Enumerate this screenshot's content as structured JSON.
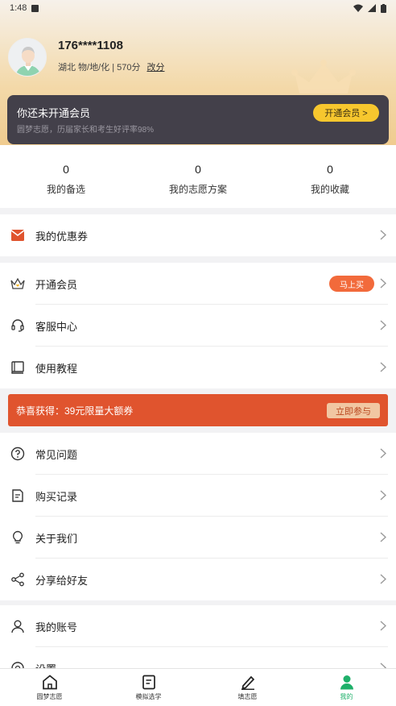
{
  "status_bar": {
    "time": "1:48"
  },
  "profile": {
    "phone": "176****1108",
    "info": "湖北 物/地/化 | 570分",
    "edit_label": "改分"
  },
  "vip": {
    "title": "你还未开通会员",
    "subtitle": "圆梦志愿，历届家长和考生好评率98%",
    "button": "开通会员 >"
  },
  "stats": [
    {
      "value": "0",
      "label": "我的备选"
    },
    {
      "value": "0",
      "label": "我的志愿方案"
    },
    {
      "value": "0",
      "label": "我的收藏"
    }
  ],
  "menu": {
    "coupon": "我的优惠券",
    "open_vip": "开通会员",
    "buy_now": "马上买",
    "service": "客服中心",
    "tutorial": "使用教程",
    "faq": "常见问题",
    "purchase": "购买记录",
    "about": "关于我们",
    "share": "分享给好友",
    "account": "我的账号",
    "settings": "设置"
  },
  "promo": {
    "text": "恭喜获得：39元限量大额券",
    "button": "立即参与"
  },
  "tabs": [
    {
      "label": "圆梦志愿"
    },
    {
      "label": "模拟选学"
    },
    {
      "label": "填志愿"
    },
    {
      "label": "我的"
    }
  ],
  "colors": {
    "accent": "#1fb06a",
    "promo": "#e0542e",
    "vip_button": "#f7c72e",
    "badge": "#f26a3b"
  }
}
